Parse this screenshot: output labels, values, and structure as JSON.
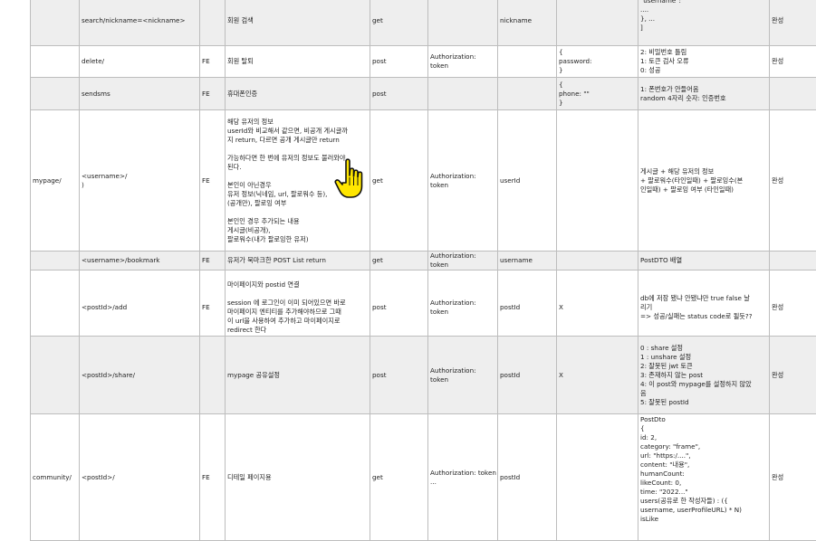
{
  "table_top": {
    "rows": [
      {
        "id": "row-search",
        "shade": true,
        "page": "",
        "url": "search/nickname=<nickname>",
        "fe": "",
        "feature": "회원 검색",
        "method": "get",
        "header": "",
        "path_var": "nickname",
        "body": "",
        "response": [
          "\"username\":",
          "....",
          "}, ...",
          "]"
        ],
        "status": "완성"
      },
      {
        "id": "row-delete",
        "shade": false,
        "page": "",
        "url": "delete/",
        "fe": "FE",
        "feature": "회원 탈퇴",
        "method": "post",
        "header": "Authorization: token",
        "path_var": "",
        "body": [
          "{",
          "password:",
          "}"
        ],
        "response": [
          "2: 비밀번호 틀림",
          "1: 토큰 검사 오류",
          "0: 성공"
        ],
        "status": "완성"
      },
      {
        "id": "row-sendsms",
        "shade": true,
        "page": "",
        "url": "sendsms",
        "fe": "FE",
        "feature": "휴대폰인증",
        "method": "post",
        "header": "",
        "path_var": "",
        "body": [
          "{",
          "phone: \"\"",
          "}"
        ],
        "response": [
          "1: 폰번호가 안들어옴",
          "random 4자리 숫자: 인증번호"
        ],
        "status": ""
      },
      {
        "id": "row-mypage",
        "shade": false,
        "page": "mypage/",
        "url": [
          "<username>/",
          ")"
        ],
        "fe": "FE",
        "feature": [
          "해당 유저의 정보",
          "userId와 비교해서 같으면, 비공개 게시글까",
          "지 return, 다르면 공개 게시글만 return",
          "",
          "가능하다면 한 번에 유저의 정보도 불러와야",
          "된다.",
          "",
          "본인이 아닌경우",
          "유저 정보(닉네임, url, 팔로워수 등),",
          "(공개만), 팔로잉 여부",
          "",
          "본인인 경우 추가되는 내용",
          "게시글(비공개),",
          "팔로워수(내가 팔로잉한 유저)"
        ],
        "method": "get",
        "header": "Authorization: token",
        "path_var": "userId",
        "body": "",
        "response": [
          "게시글 + 해당 유저의 정보",
          "+ 팔로워수(타인일때) + 팔로잉수(본",
          "인일때) + 팔로잉 여부 (타인일때)"
        ],
        "status": "완성"
      },
      {
        "id": "row-bookmark",
        "shade": true,
        "page": "",
        "url": "<username>/bookmark",
        "fe": "FE",
        "feature": "유저가 북마크한 POST List return",
        "method": "get",
        "header": "Authorization: token",
        "path_var": "username",
        "body": "",
        "response": [
          "PostDTO 배열"
        ],
        "status": ""
      },
      {
        "id": "row-add",
        "shade": false,
        "page": "",
        "url": "<postId>/add",
        "fe": "FE",
        "feature": [
          "마이페이지와 postid 연결",
          "",
          "session 에 로그인이 이미 되어있으면 바로",
          "마이페이지 엔티티를 추가해야하므로 그때",
          "이 url을 사용하여 추가하고 마이페이지로",
          "redirect 한다"
        ],
        "method": "post",
        "header": "Authorization: token",
        "path_var": "postId",
        "body": "X",
        "response": [
          "db에 저장 됐냐 안됐냐만 true false 날",
          "리기",
          "=> 성공/실패는 status code로 될듯??"
        ],
        "status": "완성"
      }
    ]
  },
  "table_bottom": {
    "rows": [
      {
        "id": "row-share",
        "shade": true,
        "page": "",
        "url": "<postId>/share/",
        "fe": "",
        "feature": "mypage 공유설정",
        "method": "post",
        "header": "Authorization: token",
        "path_var": "postId",
        "body": "X",
        "response": [
          "0 : share 설정",
          "1 : unshare 설정",
          "2:  잘못된 jwt 토큰",
          "3: 존재하지 않는 post",
          "4: 이 post와 mypage를 설정하지 않았",
          "음",
          "5: 잘못된 postId"
        ],
        "status": "완성"
      },
      {
        "id": "row-community",
        "shade": false,
        "page": "community/",
        "url": "<postId>/",
        "fe": "FE",
        "feature": "디테일 페이지용",
        "method": "get",
        "header": [
          "Authorization: token",
          "..."
        ],
        "path_var": "postId",
        "body": "",
        "response": [
          "PostDto",
          "{",
          "id: 2,",
          "category: \"frame\",",
          "url: \"https:/....\",",
          "content: \"내용\",",
          "humanCount:",
          "likeCount: 0,",
          "time: \"2022...\"",
          "users(공유로 한 작성자들) : ({",
          "username, userProfileURL) * N)",
          "isLike"
        ],
        "status": "완성"
      }
    ]
  },
  "cursor": {
    "icon": "hand-pointer-icon",
    "color": "#ffe600"
  }
}
